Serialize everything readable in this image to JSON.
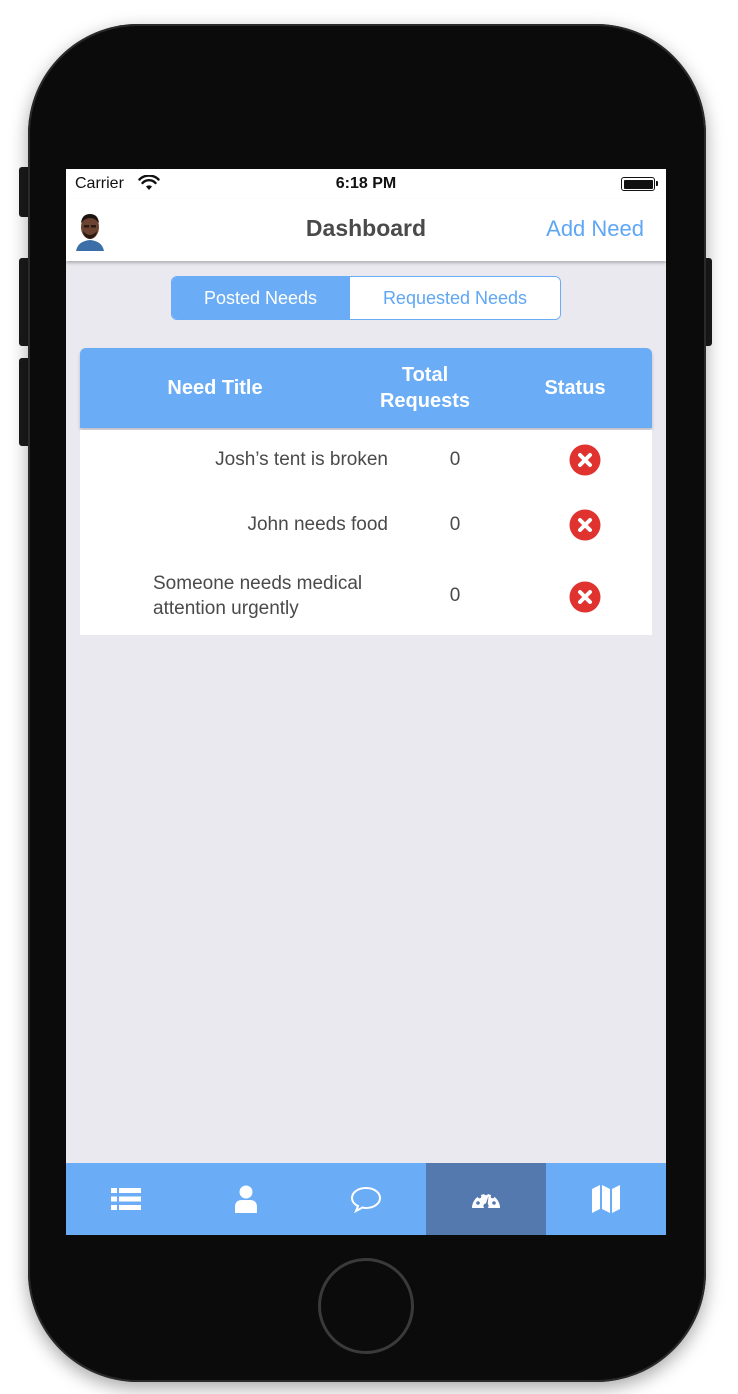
{
  "status_bar": {
    "carrier": "Carrier",
    "time": "6:18 PM"
  },
  "nav": {
    "title": "Dashboard",
    "add_button": "Add Need"
  },
  "segments": {
    "posted": "Posted Needs",
    "requested": "Requested Needs",
    "selected": "posted"
  },
  "table": {
    "headers": {
      "title": "Need Title",
      "total_line1": "Total",
      "total_line2": "Requests",
      "status": "Status"
    },
    "rows": [
      {
        "title": "Josh’s tent is broken",
        "count": "0",
        "status_icon": "x-circle-icon"
      },
      {
        "title": "John needs food",
        "count": "0",
        "status_icon": "x-circle-icon"
      },
      {
        "title_line1": "Someone needs medical",
        "title_line2": "attention urgently",
        "count": "0",
        "status_icon": "x-circle-icon"
      }
    ]
  },
  "tab_bar": {
    "items": [
      {
        "icon": "list-icon"
      },
      {
        "icon": "person-icon"
      },
      {
        "icon": "chat-bubble-icon"
      },
      {
        "icon": "dashboard-gauge-icon",
        "selected": true
      },
      {
        "icon": "map-icon"
      }
    ]
  },
  "colors": {
    "accent": "#6aacf6",
    "tab_selected": "#5479ae",
    "status_error": "#e0322f",
    "background": "#e9e9ef"
  }
}
